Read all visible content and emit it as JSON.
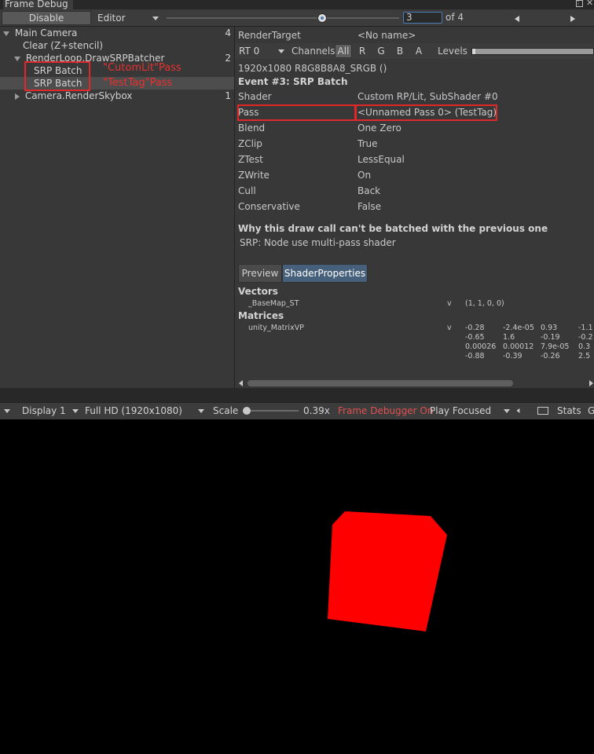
{
  "window": {
    "title": "Frame Debug"
  },
  "toolbar": {
    "disable_label": "Disable",
    "target_value": "Editor",
    "event_value": "3",
    "event_total": "of 4",
    "event_progress": 0.67
  },
  "tree": {
    "items": [
      {
        "label": "Main Camera",
        "count": "4"
      },
      {
        "label": "Clear (Z+stencil)",
        "count": ""
      },
      {
        "label": "RenderLoop.DrawSRPBatcher",
        "count": "2"
      },
      {
        "label": "SRP Batch",
        "count": ""
      },
      {
        "label": "SRP Batch",
        "count": ""
      },
      {
        "label": "Camera.RenderSkybox",
        "count": "1"
      }
    ],
    "annotations": [
      "\"CutomLit\"Pass",
      "\"TestTag\"Pass"
    ]
  },
  "details": {
    "render_target_label": "RenderTarget",
    "render_target_value": "<No name>",
    "rt_value": "RT 0",
    "channels_label": "Channels",
    "channels": [
      "All",
      "R",
      "G",
      "B",
      "A"
    ],
    "levels_label": "Levels",
    "format": "1920x1080 R8G8B8A8_SRGB ()",
    "event_title": "Event #3: SRP Batch",
    "props": [
      {
        "name": "Shader",
        "value": "Custom RP/Lit, SubShader #0"
      },
      {
        "name": "Pass",
        "value": "<Unnamed Pass 0> (TestTag)"
      },
      {
        "name": "Blend",
        "value": "One Zero"
      },
      {
        "name": "ZClip",
        "value": "True"
      },
      {
        "name": "ZTest",
        "value": "LessEqual"
      },
      {
        "name": "ZWrite",
        "value": "On"
      },
      {
        "name": "Cull",
        "value": "Back"
      },
      {
        "name": "Conservative",
        "value": "False"
      }
    ],
    "batch_reason_title": "Why this draw call can't be batched with the previous one",
    "batch_reason": "SRP: Node use multi-pass shader",
    "tabs": [
      "Preview",
      "ShaderProperties"
    ],
    "vectors_label": "Vectors",
    "vector_name": "_BaseMap_ST",
    "vector_type": "v",
    "vector_value": "(1, 1, 0, 0)",
    "matrices_label": "Matrices",
    "matrix_name": "unity_MatrixVP",
    "matrix_type": "v",
    "matrix_rows": [
      [
        "-0.28",
        "-2.4e-05",
        "0.93",
        "-1.1"
      ],
      [
        "-0.65",
        "1.6",
        "-0.19",
        "-0.2"
      ],
      [
        "0.00026",
        "0.00012",
        "7.9e-05",
        "0.3"
      ],
      [
        "-0.88",
        "-0.39",
        "-0.26",
        "2.5"
      ]
    ]
  },
  "gamebar": {
    "display": "Display 1",
    "resolution": "Full HD (1920x1080)",
    "scale_label": "Scale",
    "scale_value": "0.39x",
    "frame_debugger": "Frame Debugger On",
    "play_mode": "Play Focused",
    "stats": "Stats",
    "gizmos": "G"
  },
  "colors": {
    "accent": "#4c7cb5",
    "highlight": "#e02828",
    "cube": "#ff0000"
  }
}
